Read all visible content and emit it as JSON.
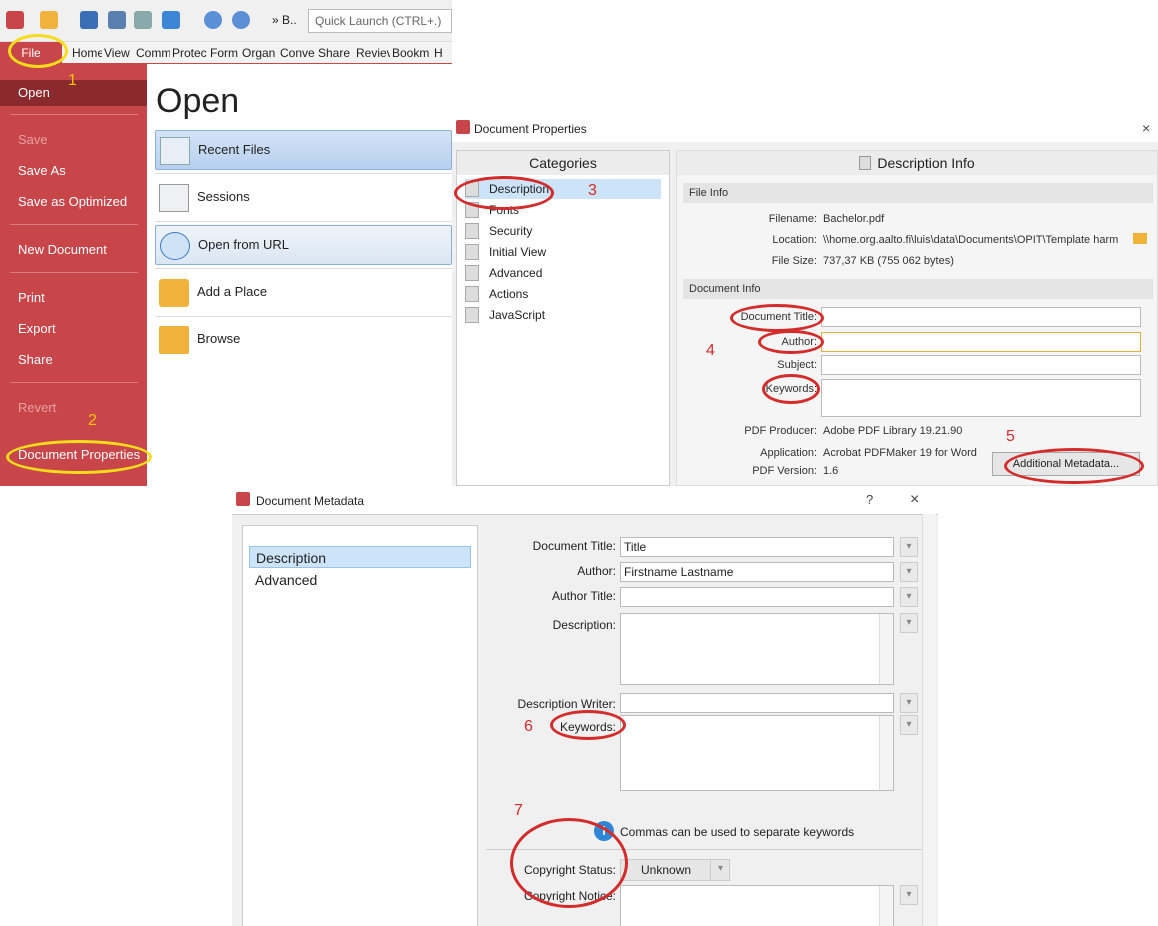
{
  "panel1": {
    "quick_launch_placeholder": "Quick Launch (CTRL+.)",
    "qa_extra": "» B..",
    "ribbon_tabs": [
      "File",
      "Home",
      "View",
      "Comm",
      "Protec",
      "Form",
      "Organ",
      "Conve",
      "Share",
      "Reviev",
      "Bookm",
      "H"
    ],
    "open_heading": "Open",
    "menu": [
      {
        "label": "Open",
        "state": "active"
      },
      {
        "label": "Save",
        "state": "disabled"
      },
      {
        "label": "Save As",
        "state": "normal"
      },
      {
        "label": "Save as Optimized",
        "state": "normal"
      },
      {
        "label": "New Document",
        "state": "normal"
      },
      {
        "label": "Print",
        "state": "normal"
      },
      {
        "label": "Export",
        "state": "normal"
      },
      {
        "label": "Share",
        "state": "normal"
      },
      {
        "label": "Revert",
        "state": "disabled"
      },
      {
        "label": "Document Properties",
        "state": "normal"
      }
    ],
    "open_items": [
      "Recent Files",
      "Sessions",
      "Open from URL",
      "Add a Place",
      "Browse"
    ]
  },
  "panel2": {
    "title": "Document Properties",
    "close": "×",
    "categories_header": "Categories",
    "categories": [
      "Description",
      "Fonts",
      "Security",
      "Initial View",
      "Advanced",
      "Actions",
      "JavaScript"
    ],
    "desc_header": "Description Info",
    "file_info_header": "File Info",
    "filename_label": "Filename:",
    "filename": "Bachelor.pdf",
    "location_label": "Location:",
    "location": "\\\\home.org.aalto.fi\\luis\\data\\Documents\\OPIT\\Template harm",
    "filesize_label": "File Size:",
    "filesize": "737,37 KB (755 062 bytes)",
    "doc_info_header": "Document Info",
    "doc_title_label": "Document Title:",
    "author_label": "Author:",
    "subject_label": "Subject:",
    "keywords_label": "Keywords:",
    "producer_label": "PDF Producer:",
    "producer": "Adobe PDF Library 19.21.90",
    "application_label": "Application:",
    "application": "Acrobat PDFMaker 19 for Word",
    "version_label": "PDF Version:",
    "version": "1.6",
    "additional_button": "Additional Metadata..."
  },
  "panel3": {
    "title": "Document Metadata",
    "help": "?",
    "close": "×",
    "categories": [
      "Description",
      "Advanced"
    ],
    "doc_title_label": "Document Title:",
    "doc_title": "Title",
    "author_label": "Author:",
    "author": "Firstname Lastname",
    "author_title_label": "Author Title:",
    "description_label": "Description:",
    "desc_writer_label": "Description Writer:",
    "keywords_label": "Keywords:",
    "info_text": "Commas can be used to separate keywords",
    "copyright_status_label": "Copyright Status:",
    "copyright_status": "Unknown",
    "copyright_notice_label": "Copyright Notice:"
  },
  "annotations": {
    "n1": "1",
    "n2": "2",
    "n3": "3",
    "n4": "4",
    "n5": "5",
    "n6": "6",
    "n7": "7"
  },
  "colors": {
    "accent_red": "#c8454a",
    "annotation_red": "#d42b2b",
    "annotation_yellow": "#f7dc1a",
    "selection_blue": "#cde3f8"
  }
}
